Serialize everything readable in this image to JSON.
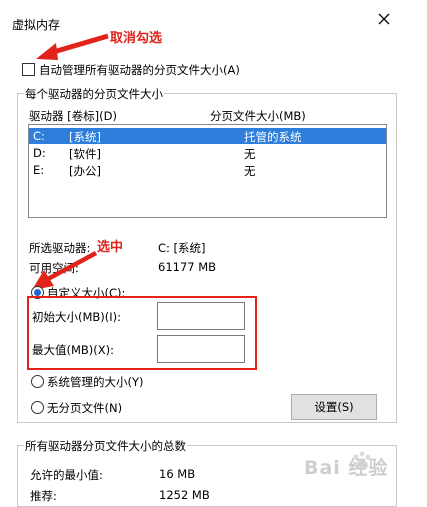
{
  "window": {
    "title": "虚拟内存"
  },
  "annotations": {
    "uncheck_hint": "取消勾选",
    "select_hint": "选中"
  },
  "auto_manage": {
    "label": "自动管理所有驱动器的分页文件大小(A)",
    "checked": false
  },
  "drive_group": {
    "legend": "每个驱动器的分页文件大小",
    "col_drive": "驱动器 [卷标](D)",
    "col_size": "分页文件大小(MB)",
    "rows": [
      {
        "letter": "C:",
        "label": "[系统]",
        "size": "托管的系统",
        "selected": true
      },
      {
        "letter": "D:",
        "label": "[软件]",
        "size": "无",
        "selected": false
      },
      {
        "letter": "E:",
        "label": "[办公]",
        "size": "无",
        "selected": false
      }
    ],
    "selected_drive_label": "所选驱动器:",
    "selected_drive_value": "C:  [系统]",
    "available_label": "可用空间:",
    "available_value": "61177 MB",
    "custom_size_label": "自定义大小(C):",
    "initial_size_label": "初始大小(MB)(I):",
    "initial_size_value": "",
    "max_size_label": "最大值(MB)(X):",
    "max_size_value": "",
    "system_managed_label": "系统管理的大小(Y)",
    "no_paging_label": "无分页文件(N)",
    "set_button": "设置(S)"
  },
  "total_group": {
    "legend": "所有驱动器分页文件大小的总数",
    "min_label": "允许的最小值:",
    "min_value": "16 MB",
    "recommended_label": "推荐:",
    "recommended_value": "1252 MB"
  },
  "watermark": {
    "text": "Bai 经验"
  },
  "colors": {
    "accent": "#e0241c",
    "selection": "#2e7fdc"
  }
}
